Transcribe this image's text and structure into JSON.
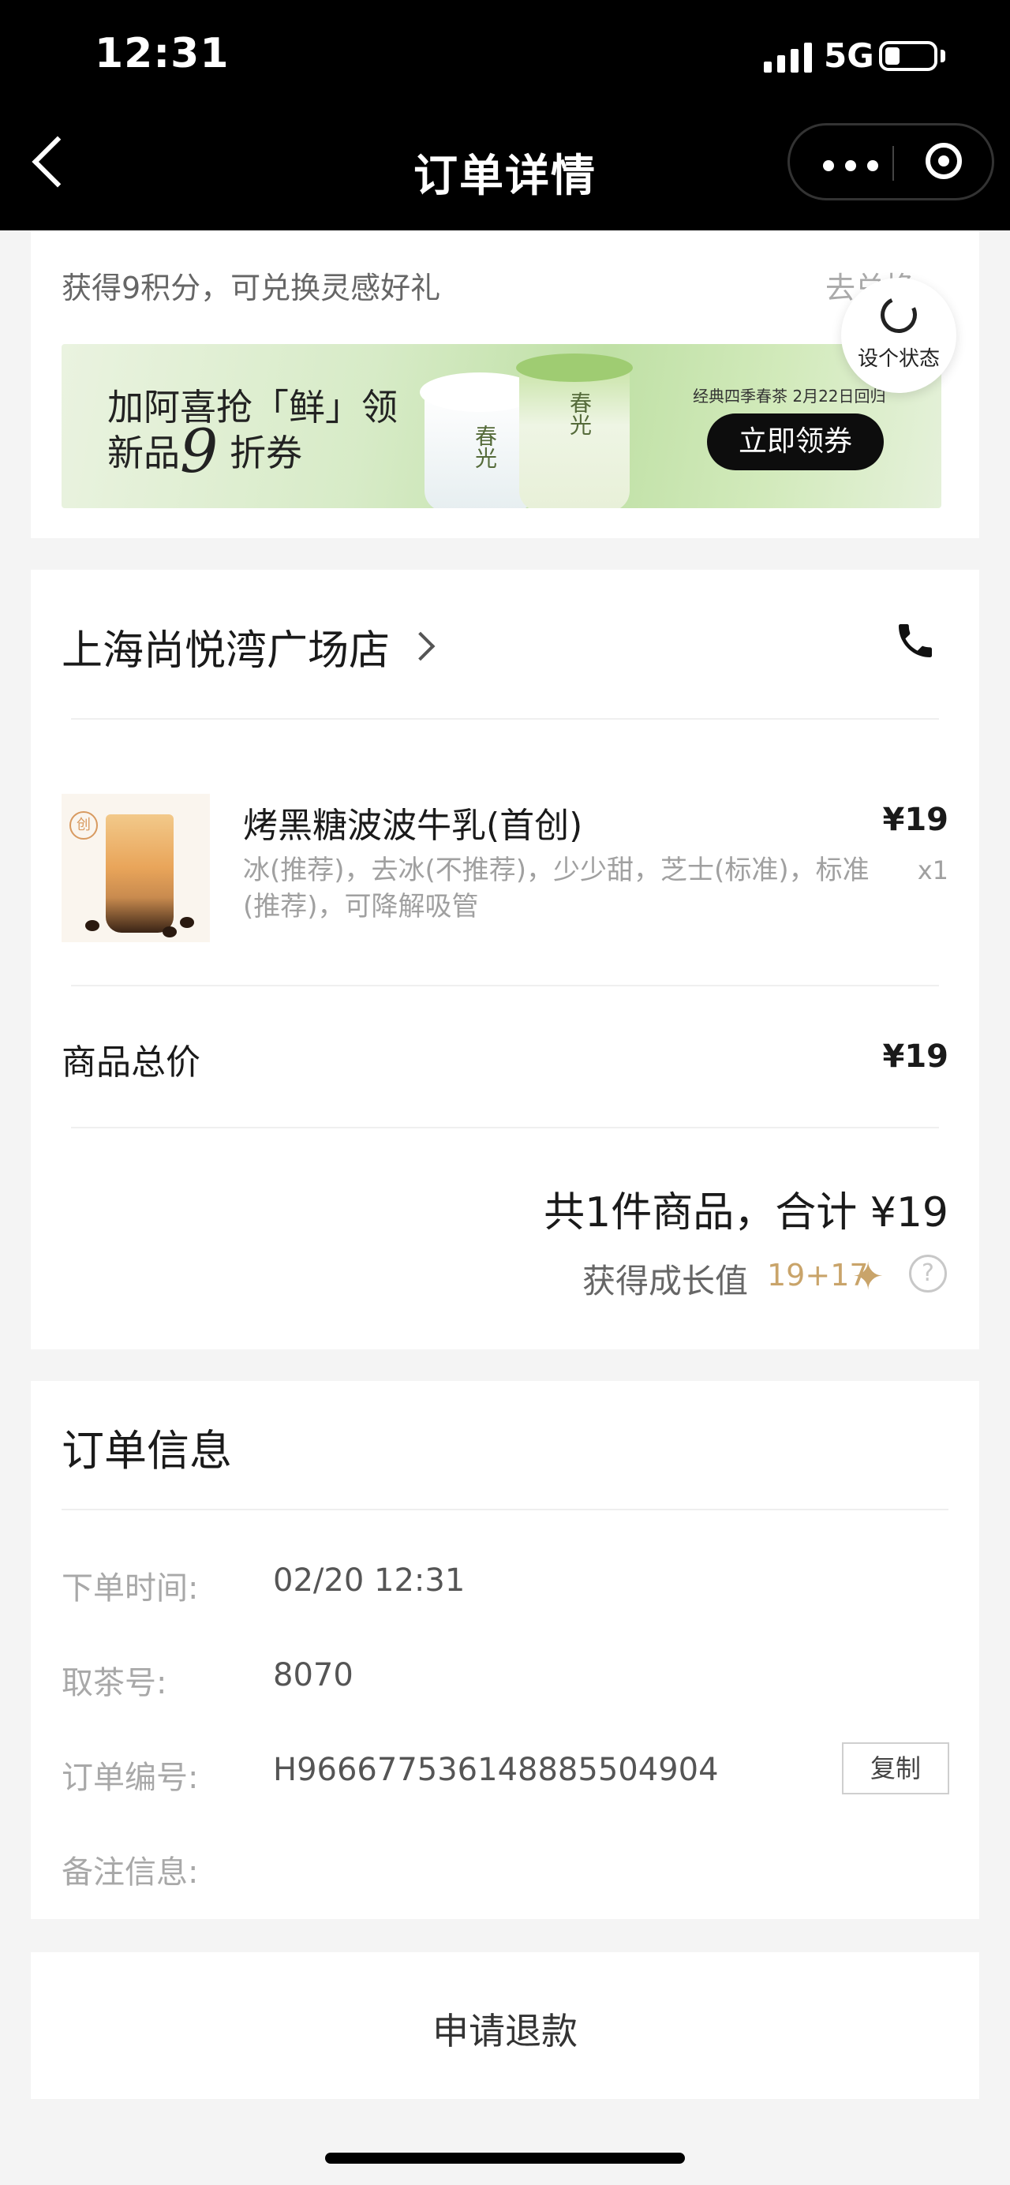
{
  "status_bar": {
    "time": "12:31",
    "network": "5G"
  },
  "nav": {
    "title": "订单详情"
  },
  "points": {
    "text": "获得9积分，可兑换灵感好礼",
    "exchange_link": "去兑换"
  },
  "banner": {
    "line1": "加阿喜抢「鲜」领",
    "line2_prefix": "新品",
    "line2_number": "9",
    "line2_suffix": " 折券",
    "promo": "经典四季春茶 2月22日回归",
    "button": "立即领券",
    "cup_label": "春光"
  },
  "status_float": {
    "label": "设个状态"
  },
  "store": {
    "name": "上海尚悦湾广场店"
  },
  "product": {
    "badge": "创",
    "name": "烤黑糖波波牛乳(首创)",
    "options": "冰(推荐)，去冰(不推荐)，少少甜，芝士(标准)，标准(推荐)，可降解吸管",
    "price": "¥19",
    "quantity": "x1"
  },
  "subtotal": {
    "label": "商品总价",
    "value": "¥19"
  },
  "summary": {
    "total": "共1件商品，合计 ¥19",
    "growth_label": "获得成长值",
    "growth_value": "19+17",
    "help": "?"
  },
  "order_info": {
    "title": "订单信息",
    "time_label": "下单时间:",
    "time_value": "02/20 12:31",
    "pickup_label": "取茶号:",
    "pickup_value": "8070",
    "order_no_label": "订单编号:",
    "order_no_value": "H966677536148885504904",
    "copy_label": "复制",
    "remark_label": "备注信息:"
  },
  "refund": {
    "label": "申请退款"
  },
  "colors": {
    "accent_gold": "#c9a46a",
    "nav_bg": "#000000",
    "banner_green": "#bfe0a5"
  }
}
